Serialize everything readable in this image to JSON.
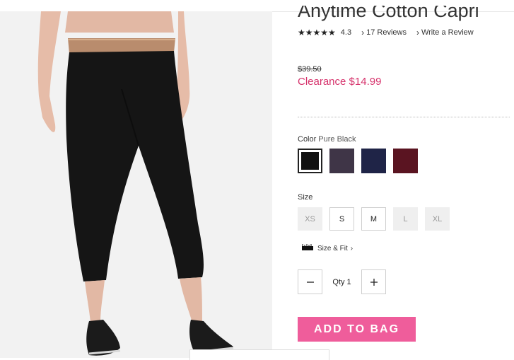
{
  "product": {
    "title": "Anytime Cotton Capri",
    "rating": {
      "stars": "★★★★★",
      "value": "4.3",
      "reviews_label": "17 Reviews",
      "write_label": "Write a Review"
    },
    "price": {
      "original": "$39.50",
      "clearance": "Clearance $14.99"
    },
    "color": {
      "label": "Color",
      "selected": "Pure Black",
      "swatches": [
        "#111111",
        "#3f3547",
        "#1f2447",
        "#5a1421"
      ]
    },
    "size": {
      "label": "Size",
      "options": [
        "XS",
        "S",
        "M",
        "L",
        "XL"
      ],
      "available": [
        false,
        true,
        true,
        false,
        false
      ]
    },
    "fit_label": "Size & Fit",
    "quantity": {
      "label": "Qty",
      "value": "1"
    },
    "add_to_bag": "ADD TO BAG"
  },
  "colors": {
    "sale": "#d6336c",
    "add_button": "#ef5d9b",
    "accent_text": "#333333"
  }
}
